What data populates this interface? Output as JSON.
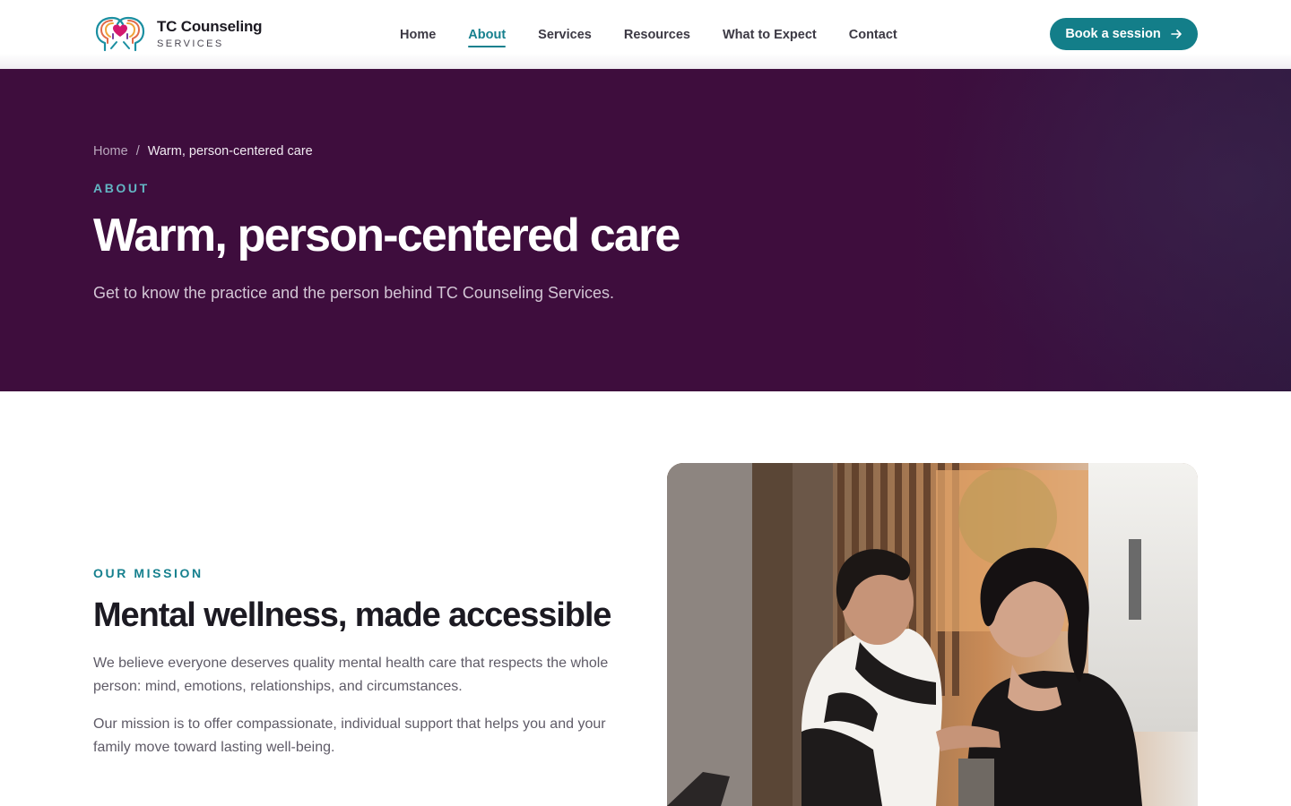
{
  "header": {
    "logo": {
      "name": "TC Counseling",
      "sub": "SERVICES",
      "icon": "heart-in-heads-logo-icon"
    },
    "nav": [
      {
        "label": "Home",
        "active": false
      },
      {
        "label": "About",
        "active": true
      },
      {
        "label": "Services",
        "active": false
      },
      {
        "label": "Resources",
        "active": false
      },
      {
        "label": "What to Expect",
        "active": false
      },
      {
        "label": "Contact",
        "active": false
      }
    ],
    "cta": {
      "label": "Book a session",
      "icon": "arrow-right-icon"
    }
  },
  "hero": {
    "breadcrumb": {
      "home": "Home",
      "separator": "/",
      "current": "Warm, person-centered care"
    },
    "eyebrow": "ABOUT",
    "title": "Warm, person-centered care",
    "subtitle": "Get to know the practice and the person behind TC Counseling Services."
  },
  "mission": {
    "eyebrow": "OUR MISSION",
    "title": "Mental wellness, made accessible",
    "paragraphs": [
      "We believe everyone deserves quality mental health care that respects the whole person: mind, emotions, relationships, and circumstances.",
      "Our mission is to offer compassionate, individual support that helps you and your family move toward lasting well-being."
    ],
    "image_subject": "two-people-smiling-at-cafe-photo"
  },
  "colors": {
    "brand_teal": "#137e89",
    "hero_plum": "#3e0d3d",
    "eyebrow_teal": "#16808e",
    "eyebrow_light": "#63b6c4"
  }
}
